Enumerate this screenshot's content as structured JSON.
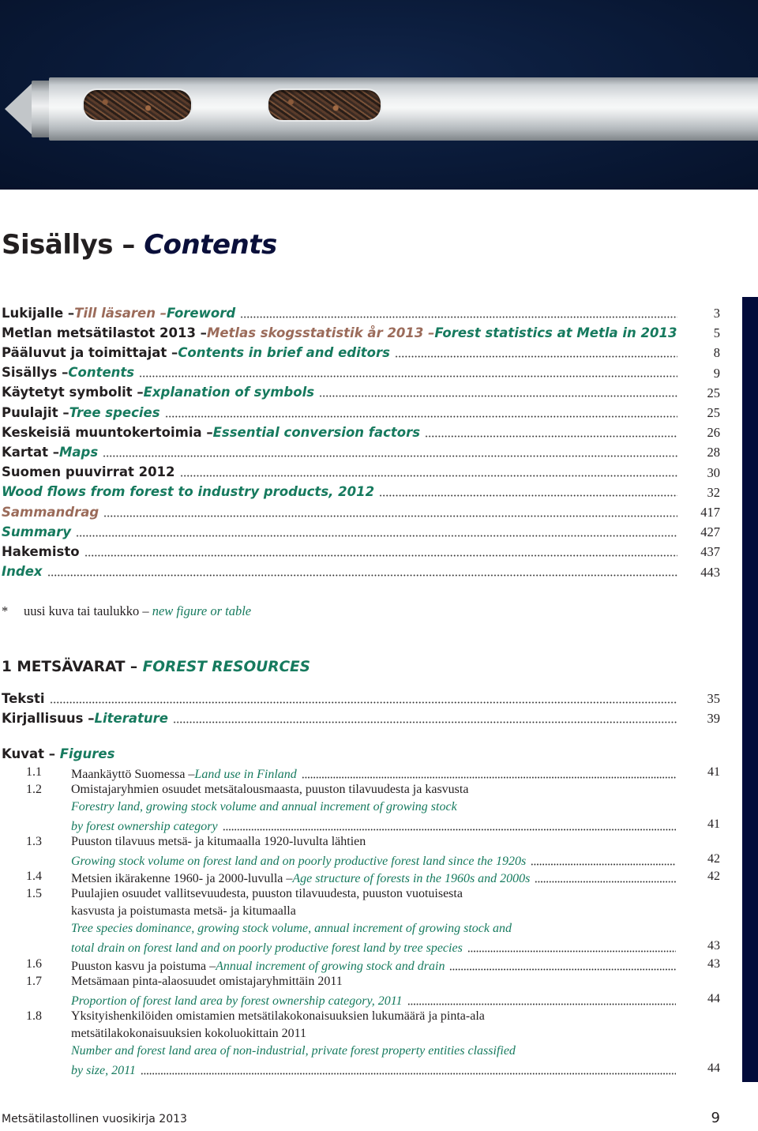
{
  "hero": {
    "image_description": "Metal seed sampling probe with two windows filled with seeds on dark blue background"
  },
  "colors": {
    "finnish_text": "#231f20",
    "swedish_text": "#9b6b5a",
    "english_text": "#167a5e",
    "side_tab": "#020b3a",
    "title_english": "#0a0f3a"
  },
  "title": {
    "fi": "Sisällys",
    "sep": " – ",
    "en": "Contents"
  },
  "toc": [
    {
      "fi": "Lukijalle – ",
      "sv": "Till läsaren – ",
      "en": "Foreword",
      "page": "3"
    },
    {
      "fi": "Metlan metsätilastot 2013 – ",
      "sv": "Metlas skogsstatistik år 2013 – ",
      "en": "Forest statistics at Metla in 2013",
      "page": "5"
    },
    {
      "fi": "Pääluvut ja toimittajat – ",
      "sv": "",
      "en": "Contents in brief and editors",
      "page": "8"
    },
    {
      "fi": "Sisällys – ",
      "sv": "",
      "en": "Contents",
      "page": "9"
    },
    {
      "fi": "Käytetyt symbolit – ",
      "sv": "",
      "en": "Explanation of symbols",
      "page": "25"
    },
    {
      "fi": "Puulajit – ",
      "sv": "",
      "en": "Tree species",
      "page": "25"
    },
    {
      "fi": "Keskeisiä muuntokertoimia – ",
      "sv": "",
      "en": "Essential conversion factors",
      "page": "26"
    },
    {
      "fi": "Kartat – ",
      "sv": "",
      "en": "Maps",
      "page": "28"
    },
    {
      "fi": "Suomen puuvirrat 2012",
      "sv": "",
      "en": "",
      "page": "30"
    },
    {
      "fi": "",
      "sv": "",
      "en": "Wood flows from forest to industry products, 2012",
      "page": "32"
    },
    {
      "fi": "",
      "sv": "Sammandrag",
      "en": "",
      "page": "417"
    },
    {
      "fi": "",
      "sv": "",
      "en": "Summary",
      "page": "427"
    },
    {
      "fi": "Hakemisto",
      "sv": "",
      "en": "",
      "page": "437"
    },
    {
      "fi": "",
      "sv": "",
      "en": "Index",
      "page": "443"
    }
  ],
  "footnote": {
    "symbol": "*",
    "fi": "uusi kuva tai taulukko – ",
    "en": "new figure or table"
  },
  "section": {
    "fi": "1 METSÄVARAT – ",
    "en": "FOREST RESOURCES",
    "entries": [
      {
        "fi": "Teksti",
        "en": "",
        "page": "35"
      },
      {
        "fi": "Kirjallisuus – ",
        "en": "Literature",
        "page": "39"
      }
    ],
    "figures_heading": {
      "fi": "Kuvat – ",
      "en": "Figures"
    },
    "figures": [
      {
        "num": "1.1",
        "lines": [
          {
            "fi": "Maankäyttö Suomessa – ",
            "en": "Land use in Finland"
          }
        ],
        "page": "41"
      },
      {
        "num": "1.2",
        "lines": [
          {
            "fi": "Omistajaryhmien osuudet metsätalousmaasta, puuston tilavuudesta ja kasvusta",
            "en": ""
          },
          {
            "fi": "",
            "en": "Forestry land, growing stock volume and annual increment of growing stock"
          },
          {
            "fi": "",
            "en": "by forest ownership category"
          }
        ],
        "page": "41"
      },
      {
        "num": "1.3",
        "lines": [
          {
            "fi": "Puuston tilavuus metsä- ja kitumaalla 1920-luvulta lähtien",
            "en": ""
          },
          {
            "fi": "",
            "en": "Growing stock volume on forest land and on poorly productive forest land since the 1920s"
          }
        ],
        "page": "42"
      },
      {
        "num": "1.4",
        "lines": [
          {
            "fi": "Metsien ikärakenne 1960- ja 2000-luvulla – ",
            "en": "Age structure of forests in the 1960s and 2000s"
          }
        ],
        "page": "42"
      },
      {
        "num": "1.5",
        "lines": [
          {
            "fi": "Puulajien osuudet vallitsevuudesta, puuston tilavuudesta, puuston vuotuisesta",
            "en": ""
          },
          {
            "fi": "kasvusta ja poistumasta metsä- ja kitumaalla",
            "en": ""
          },
          {
            "fi": "",
            "en": "Tree species dominance, growing stock volume, annual increment of growing stock and"
          },
          {
            "fi": "",
            "en": "total drain on forest land and on poorly productive forest land by tree species"
          }
        ],
        "page": "43"
      },
      {
        "num": "1.6",
        "lines": [
          {
            "fi": "Puuston kasvu ja poistuma – ",
            "en": "Annual increment of growing stock and drain"
          }
        ],
        "page": "43"
      },
      {
        "num": "1.7",
        "lines": [
          {
            "fi": "Metsämaan pinta-alaosuudet omistajaryhmittäin 2011",
            "en": ""
          },
          {
            "fi": "",
            "en": "Proportion of forest land area by forest ownership category, 2011"
          }
        ],
        "page": "44"
      },
      {
        "num": "1.8",
        "lines": [
          {
            "fi": "Yksityishenkilöiden omistamien metsätilakokonaisuuksien lukumäärä ja pinta-ala",
            "en": ""
          },
          {
            "fi": "metsätilakokonaisuuksien kokoluokittain 2011",
            "en": ""
          },
          {
            "fi": "",
            "en": "Number and forest land area of non-industrial, private forest property entities classified"
          },
          {
            "fi": "",
            "en": "by size, 2011"
          }
        ],
        "page": "44"
      }
    ]
  },
  "footer": {
    "publication": "Metsätilastollinen vuosikirja 2013",
    "page_number": "9"
  }
}
